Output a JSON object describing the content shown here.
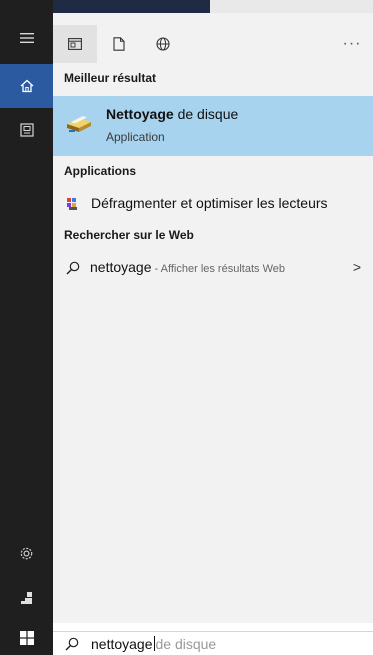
{
  "tabs": [
    {
      "icon": "apps-icon",
      "selected": true
    },
    {
      "icon": "document-icon",
      "selected": false
    },
    {
      "icon": "globe-icon",
      "selected": false
    }
  ],
  "more_label": "···",
  "sections": {
    "best_match": "Meilleur résultat",
    "applications": "Applications",
    "web": "Rechercher sur le Web"
  },
  "best_result": {
    "title_bold": "Nettoyage",
    "title_rest": " de disque",
    "subtitle": "Application",
    "icon": "disk-cleanup-icon"
  },
  "app_results": [
    {
      "label": "Défragmenter et optimiser les lecteurs",
      "icon": "defrag-icon"
    }
  ],
  "web_result": {
    "query": "nettoyage",
    "hint": " - Afficher les résultats Web",
    "chevron": ">"
  },
  "search_box": {
    "typed": "nettoyage",
    "suggestion": "de disque"
  },
  "rail_icons": [
    "hamburger-icon",
    "home-icon",
    "recent-docs-icon",
    "settings-icon",
    "user-icon",
    "windows-start-icon"
  ],
  "colors": {
    "rail": "#1f1f1f",
    "rail_active": "#2b5aa0",
    "panel": "#f2f2f2",
    "highlight": "#a7d3ee"
  }
}
